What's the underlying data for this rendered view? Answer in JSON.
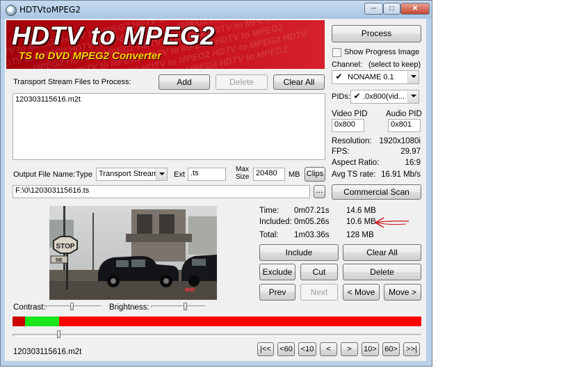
{
  "window": {
    "title": "HDTVtoMPEG2",
    "min_glyph": "─",
    "max_glyph": "□",
    "close_glyph": "✕"
  },
  "banner": {
    "title": "HDTV to MPEG2",
    "subtitle": "TS to DVD MPEG2 Converter"
  },
  "files": {
    "label": "Transport Stream Files to Process:",
    "add_label": "Add",
    "delete_label": "Delete",
    "clear_all_label": "Clear All",
    "items": [
      "120303115616.m2t"
    ]
  },
  "output": {
    "file_name_label": "Output File Name:",
    "type_label": "Type",
    "type_value": "Transport Stream",
    "ext_label": "Ext",
    "ext_value": ".ts",
    "max_size_label_1": "Max",
    "max_size_label_2": "Size",
    "max_size_value": "20480",
    "mb_label": "MB",
    "clips_label": "Clips",
    "path_value": "F:\\0\\120303115616.ts",
    "browse_label": "..."
  },
  "right_panel": {
    "process_label": "Process",
    "show_progress_label": "Show Progress Image",
    "channel_label": "Channel:",
    "channel_hint": "(select to keep)",
    "channel_value": "NONAME 0.1",
    "pids_label": "PIDs:",
    "pids_value": ".0x800(vid...",
    "video_pid_label": "Video PID",
    "audio_pid_label": "Audio PID",
    "video_pid_value": "0x800",
    "audio_pid_value": "0x801",
    "resolution_label": "Resolution:",
    "resolution_value": "1920x1080i",
    "fps_label": "FPS:",
    "fps_value": "29.97",
    "aspect_label": "Aspect Ratio:",
    "aspect_value": "16:9",
    "avg_ts_label": "Avg TS rate:",
    "avg_ts_value": "16.91 Mb/s",
    "commercial_scan_label": "Commercial Scan"
  },
  "stats": {
    "time_label": "Time:",
    "time_value": "0m07.21s",
    "time_size": "14.6 MB",
    "included_label": "Included:",
    "included_value": "0m05.26s",
    "included_size": "10.6 MB",
    "total_label": "Total:",
    "total_value": "1m03.36s",
    "total_size": "128 MB"
  },
  "edit": {
    "include_label": "Include",
    "clear_all_label": "Clear All",
    "exclude_label": "Exclude",
    "cut_label": "Cut",
    "delete_label": "Delete",
    "prev_label": "Prev",
    "next_label": "Next",
    "move_left_label": "< Move",
    "move_right_label": "Move >"
  },
  "adjust": {
    "contrast_label": "Contrast:",
    "brightness_label": "Brightness:",
    "contrast_level": 0.46,
    "brightness_level": 0.62
  },
  "timeline": {
    "base_color": "#ff0000",
    "segments": [
      {
        "start": 0.0,
        "end": 0.03,
        "color": "#cc0000"
      },
      {
        "start": 0.03,
        "end": 0.113,
        "color": "#19e619"
      }
    ],
    "position": 0.113
  },
  "nav": {
    "file_label": "120303115616.m2t",
    "buttons": [
      "|<<",
      "<60",
      "<10",
      "<",
      ">",
      "10>",
      "60>",
      ">>|"
    ]
  },
  "video": {
    "sign_text": "STOP",
    "sign_text_2": "DE"
  },
  "annotation": {
    "arrow_color": "#cc1111"
  },
  "colors": {
    "banner_red": "#b8000c",
    "banner_yellow": "#ffd400",
    "window_frame": "#b9d1ea"
  }
}
